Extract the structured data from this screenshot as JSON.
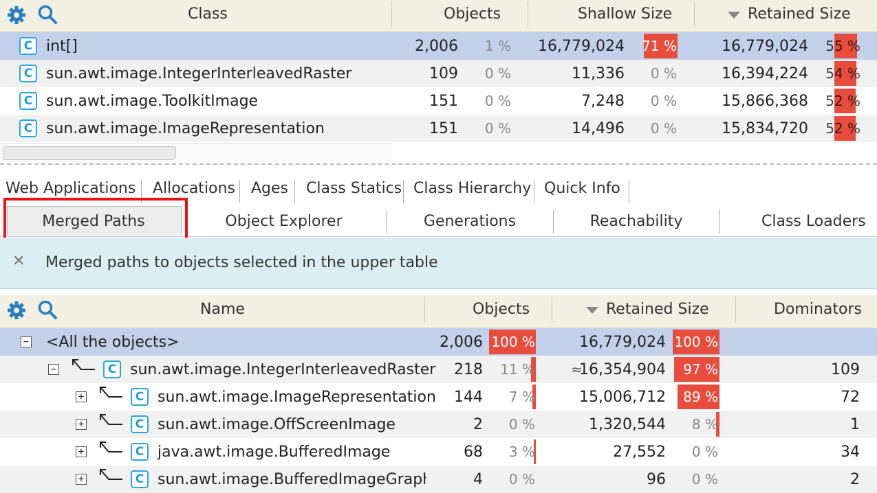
{
  "colors": {
    "accent_bar": "#e74c3c",
    "selection": "#c3d0ea",
    "banner": "#dbeff2",
    "highlight": "#ee1111"
  },
  "icons": {
    "settings": "gear-icon",
    "search": "search-icon",
    "class": "class-icon",
    "close": "close-icon"
  },
  "upper": {
    "headers": {
      "class": "Class",
      "objects": "Objects",
      "shallow": "Shallow Size",
      "retained": "Retained Size"
    },
    "rows": [
      {
        "name": "int[]",
        "objects": "2,006",
        "objects_pct": "1 %",
        "shallow": "16,779,024",
        "shallow_pct": "71 %",
        "shallow_frac": 0.71,
        "retained": "16,779,024",
        "retained_pct": "55 %",
        "retained_frac": 0.55
      },
      {
        "name": "sun.awt.image.IntegerInterleavedRaster",
        "objects": "109",
        "objects_pct": "0 %",
        "shallow": "11,336",
        "shallow_pct": "0 %",
        "shallow_frac": 0,
        "retained": "16,394,224",
        "retained_pct": "54 %",
        "retained_frac": 0.54
      },
      {
        "name": "sun.awt.image.ToolkitImage",
        "objects": "151",
        "objects_pct": "0 %",
        "shallow": "7,248",
        "shallow_pct": "0 %",
        "shallow_frac": 0,
        "retained": "15,866,368",
        "retained_pct": "52 %",
        "retained_frac": 0.52
      },
      {
        "name": "sun.awt.image.ImageRepresentation",
        "objects": "151",
        "objects_pct": "0 %",
        "shallow": "14,496",
        "shallow_pct": "0 %",
        "shallow_frac": 0,
        "retained": "15,834,720",
        "retained_pct": "52 %",
        "retained_frac": 0.52
      }
    ]
  },
  "tabs": {
    "row1": [
      "Web Applications",
      "Allocations",
      "Ages",
      "Class Statics",
      "Class Hierarchy",
      "Quick Info"
    ],
    "row2": [
      "Merged Paths",
      "Object Explorer",
      "Generations",
      "Reachability",
      "Class Loaders"
    ],
    "active": "Merged Paths"
  },
  "banner": {
    "text": "Merged paths to objects selected in the upper table",
    "close": "✕"
  },
  "lower": {
    "headers": {
      "name": "Name",
      "objects": "Objects",
      "retained": "Retained Size",
      "dominators": "Dominators"
    },
    "rows": [
      {
        "name": "<All the objects>",
        "objects": "2,006",
        "objects_pct": "100 %",
        "objects_frac": 1.0,
        "approx": "",
        "retained": "16,779,024",
        "retained_pct": "100 %",
        "retained_frac": 1.0,
        "dominators": "",
        "expander": "−"
      },
      {
        "name": "sun.awt.image.IntegerInterleavedRaster",
        "objects": "218",
        "objects_pct": "11 %",
        "objects_frac": 0.11,
        "approx": "≈",
        "retained": "16,354,904",
        "retained_pct": "97 %",
        "retained_frac": 0.97,
        "dominators": "109",
        "expander": "−"
      },
      {
        "name": "sun.awt.image.ImageRepresentation",
        "objects": "144",
        "objects_pct": "7 %",
        "objects_frac": 0.07,
        "approx": "",
        "retained": "15,006,712",
        "retained_pct": "89 %",
        "retained_frac": 0.89,
        "dominators": "72",
        "expander": "+"
      },
      {
        "name": "sun.awt.image.OffScreenImage",
        "objects": "2",
        "objects_pct": "0 %",
        "objects_frac": 0,
        "approx": "",
        "retained": "1,320,544",
        "retained_pct": "8 %",
        "retained_frac": 0.08,
        "dominators": "1",
        "expander": "+"
      },
      {
        "name": "java.awt.image.BufferedImage",
        "objects": "68",
        "objects_pct": "3 %",
        "objects_frac": 0.03,
        "approx": "",
        "retained": "27,552",
        "retained_pct": "0 %",
        "retained_frac": 0,
        "dominators": "34",
        "expander": "+"
      },
      {
        "name": "sun.awt.image.BufferedImageGraphic",
        "objects": "4",
        "objects_pct": "0 %",
        "objects_frac": 0,
        "approx": "",
        "retained": "96",
        "retained_pct": "0 %",
        "retained_frac": 0,
        "dominators": "2",
        "expander": "+"
      }
    ]
  }
}
